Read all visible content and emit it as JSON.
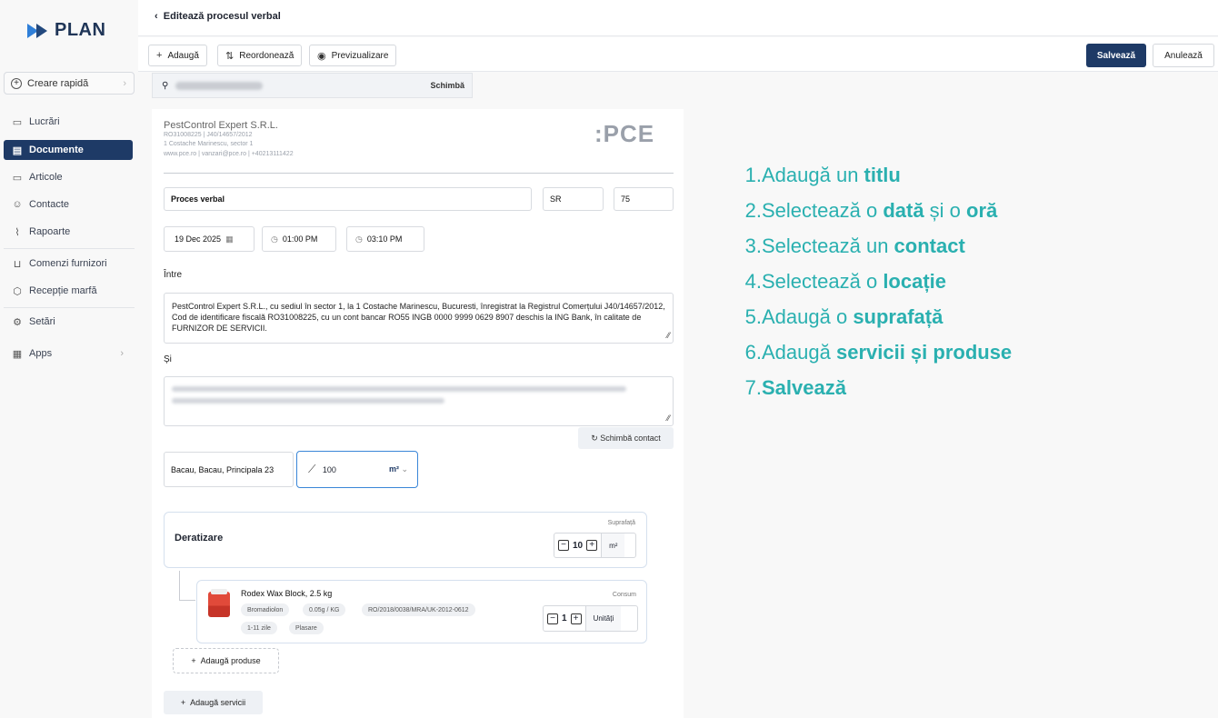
{
  "app": {
    "logo_text": "PLAN"
  },
  "sidebar": {
    "quick_create": "Creare rapidă",
    "items": [
      {
        "label": "Lucrări",
        "icon": "truck-icon"
      },
      {
        "label": "Documente",
        "icon": "document-icon",
        "active": true
      },
      {
        "label": "Articole",
        "icon": "archive-icon"
      },
      {
        "label": "Contacte",
        "icon": "users-icon"
      },
      {
        "label": "Rapoarte",
        "icon": "chart-icon"
      },
      {
        "label": "Comenzi furnizori",
        "icon": "cart-icon"
      },
      {
        "label": "Recepție marfă",
        "icon": "package-icon"
      },
      {
        "label": "Setări",
        "icon": "gear-icon"
      },
      {
        "label": "Apps",
        "icon": "grid-icon"
      }
    ]
  },
  "header": {
    "back_title": "Editează procesul verbal"
  },
  "toolbar": {
    "add": "Adaugă",
    "reorder": "Reordonează",
    "preview": "Previzualizare",
    "save": "Salvează",
    "cancel": "Anulează"
  },
  "contact_bar": {
    "change": "Schimbă"
  },
  "document": {
    "company_name": "PestControl Expert S.R.L.",
    "company_reg": "RO31008225 | J40/14657/2012",
    "company_addr": "1 Costache Marinescu, sector 1",
    "company_web": "www.pce.ro | vanzari@pce.ro | +40213111422",
    "logo": ":PCE",
    "title_value": "Proces verbal",
    "series": "SR",
    "number": "75",
    "date": "19 Dec 2025",
    "time_start": "01:00 PM",
    "time_end": "03:10 PM",
    "between_label": "Între",
    "party1_text": "PestControl Expert S.R.L., cu sediul în sector 1, la 1 Costache Marinescu, Bucuresti, înregistrat la Registrul Comerțului J40/14657/2012, Cod de identificare fiscală RO31008225, cu un cont bancar RO55 INGB 0000 9999 0629 8907 deschis la ING Bank, în calitate de FURNIZOR DE SERVICII.",
    "and_label": "Și",
    "change_contact": "Schimbă contact",
    "location": "Bacau, Bacau, Principala 23",
    "area_value": "100",
    "area_unit": "m²"
  },
  "service": {
    "name": "Deratizare",
    "area_label": "Suprafață",
    "area_value": "10",
    "area_unit": "m²",
    "product": {
      "name": "Rodex Wax Block, 2.5 kg",
      "chips": [
        "Bromadiolon",
        "0.05g / KG",
        "RO/2018/0038/MRA/UK-2012-0612",
        "1-11 zile",
        "Plasare"
      ],
      "consumption_label": "Consum",
      "qty": "1",
      "unit": "Unități"
    },
    "add_products": "Adaugă produse",
    "add_services": "Adaugă servicii"
  },
  "steps": [
    {
      "n": "1.",
      "pre": "Adaugă un ",
      "b1": "titlu",
      "mid": "",
      "b2": ""
    },
    {
      "n": "2.",
      "pre": "Selectează o ",
      "b1": "dată",
      "mid": " și o ",
      "b2": "oră"
    },
    {
      "n": "3.",
      "pre": "Selectează un ",
      "b1": "contact",
      "mid": "",
      "b2": ""
    },
    {
      "n": "4.",
      "pre": "Selectează o ",
      "b1": "locație",
      "mid": "",
      "b2": ""
    },
    {
      "n": "5.",
      "pre": "Adaugă o ",
      "b1": "suprafață",
      "mid": "",
      "b2": ""
    },
    {
      "n": "6.",
      "pre": "Adaugă ",
      "b1": "servicii și produse",
      "mid": "",
      "b2": ""
    },
    {
      "n": "7.",
      "pre": "",
      "b1": "Salvează",
      "mid": "",
      "b2": ""
    }
  ],
  "colors": {
    "accent": "#1e3a66",
    "steps": "#2ab0b0",
    "focus": "#3a86d8"
  }
}
